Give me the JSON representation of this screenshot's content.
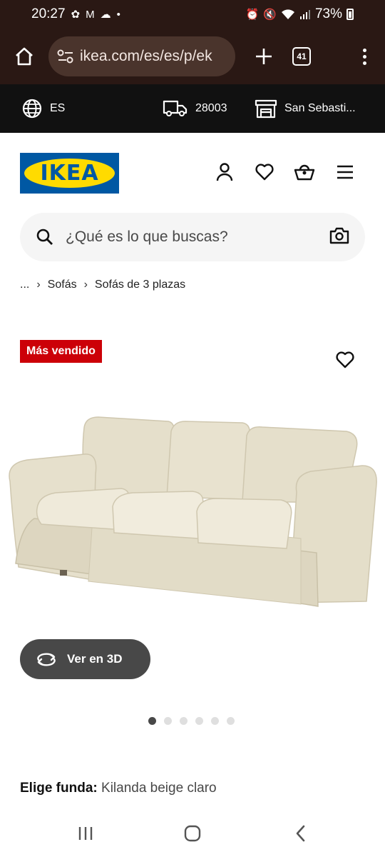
{
  "status_bar": {
    "time": "20:27",
    "battery": "73%"
  },
  "browser": {
    "url": "ikea.com/es/es/p/ek",
    "tab_count": "41"
  },
  "ikea_strip": {
    "language": "ES",
    "postcode": "28003",
    "store": "San Sebasti..."
  },
  "brand": {
    "logo_text": "IKEA",
    "blue": "#0058a3",
    "yellow": "#ffdb00"
  },
  "header_icons": [
    "user-icon",
    "heart-icon",
    "basket-icon",
    "hamburger-menu-icon"
  ],
  "search": {
    "placeholder": "¿Qué es lo que buscas?"
  },
  "breadcrumb": {
    "ellipsis": "...",
    "items": [
      "Sofás",
      "Sofás de 3 plazas"
    ]
  },
  "product": {
    "badge": "Más vendido",
    "badge_color": "#cc0008",
    "view_3d_label": "Ver en 3D",
    "image_count": 6,
    "active_image_index": 0,
    "fabric_label": "Elige funda:",
    "fabric_value": "Kilanda beige claro"
  }
}
